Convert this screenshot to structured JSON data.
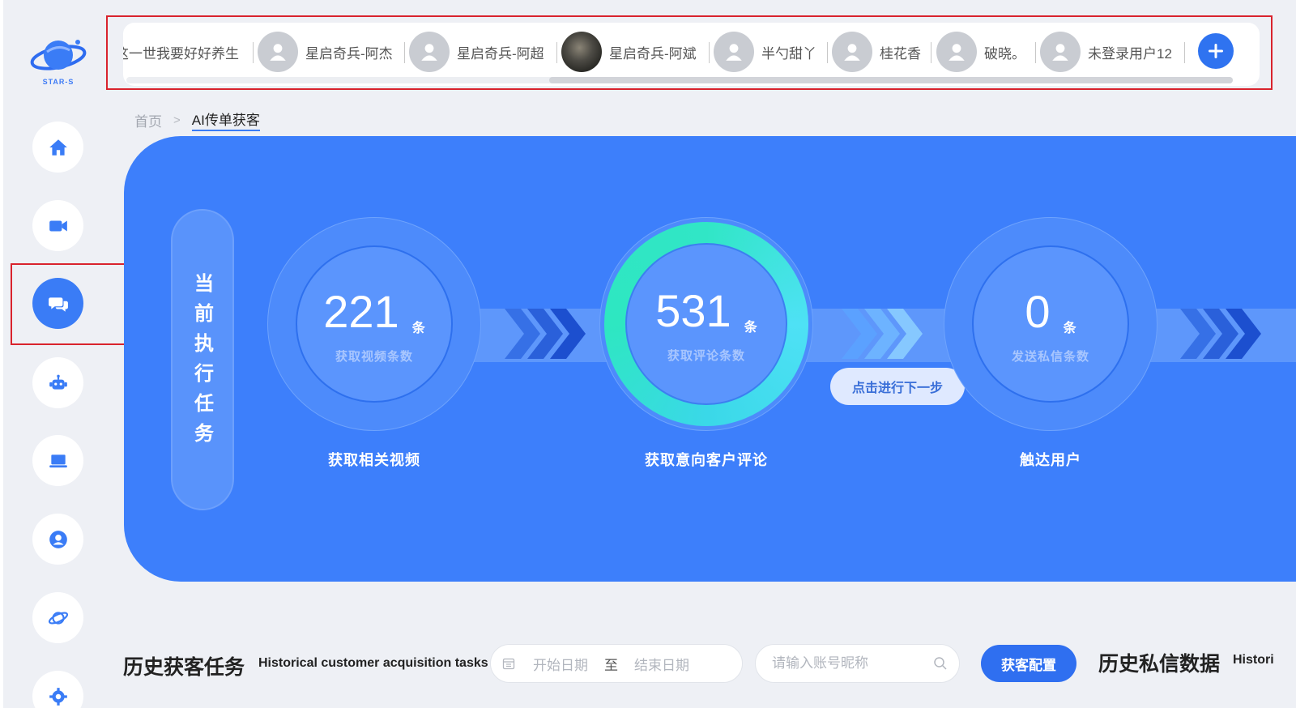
{
  "logo": {
    "text": "STAR-S"
  },
  "tabs": [
    {
      "label": "这一世我要好好养生",
      "avatar": "none"
    },
    {
      "label": "星启奇兵-阿杰",
      "avatar": "user-icon"
    },
    {
      "label": "星启奇兵-阿超",
      "avatar": "user-icon"
    },
    {
      "label": "星启奇兵-阿斌",
      "avatar": "photo"
    },
    {
      "label": "半勺甜丫",
      "avatar": "user-icon"
    },
    {
      "label": "桂花香",
      "avatar": "user-icon"
    },
    {
      "label": "破晓。",
      "avatar": "user-icon"
    },
    {
      "label": "未登录用户12",
      "avatar": "user-icon"
    }
  ],
  "sidebar": {
    "items": [
      {
        "icon": "home-icon"
      },
      {
        "icon": "video-camera-icon"
      },
      {
        "icon": "chat-bubbles-icon",
        "active": true
      },
      {
        "icon": "robot-icon"
      },
      {
        "icon": "laptop-icon"
      },
      {
        "icon": "user-circle-icon"
      },
      {
        "icon": "planet-icon"
      },
      {
        "icon": "gear-icon"
      }
    ]
  },
  "breadcrumb": {
    "home": "首页",
    "current": "AI传单获客"
  },
  "hero": {
    "current_task_chars": [
      "当",
      "前",
      "执",
      "行",
      "任",
      "务"
    ],
    "stats": [
      {
        "value": "221",
        "unit": "条",
        "label": "获取视频条数",
        "caption": "获取相关视频"
      },
      {
        "value": "531",
        "unit": "条",
        "label": "获取评论条数",
        "caption": "获取意向客户评论"
      },
      {
        "value": "0",
        "unit": "条",
        "label": "发送私信条数",
        "caption": "触达用户"
      }
    ],
    "next_button": "点击进行下一步"
  },
  "history": {
    "title": "历史获客任务",
    "subtitle": "Historical customer acquisition tasks",
    "start_placeholder": "开始日期",
    "range_sep": "至",
    "end_placeholder": "结束日期",
    "search_placeholder": "请输入账号昵称",
    "config_button": "获客配置"
  },
  "history_dm": {
    "title": "历史私信数据",
    "subtitle": "Histori"
  },
  "colors": {
    "primary": "#3d7ffb",
    "accent": "#31e6c6",
    "highlight": "#d9232d"
  }
}
